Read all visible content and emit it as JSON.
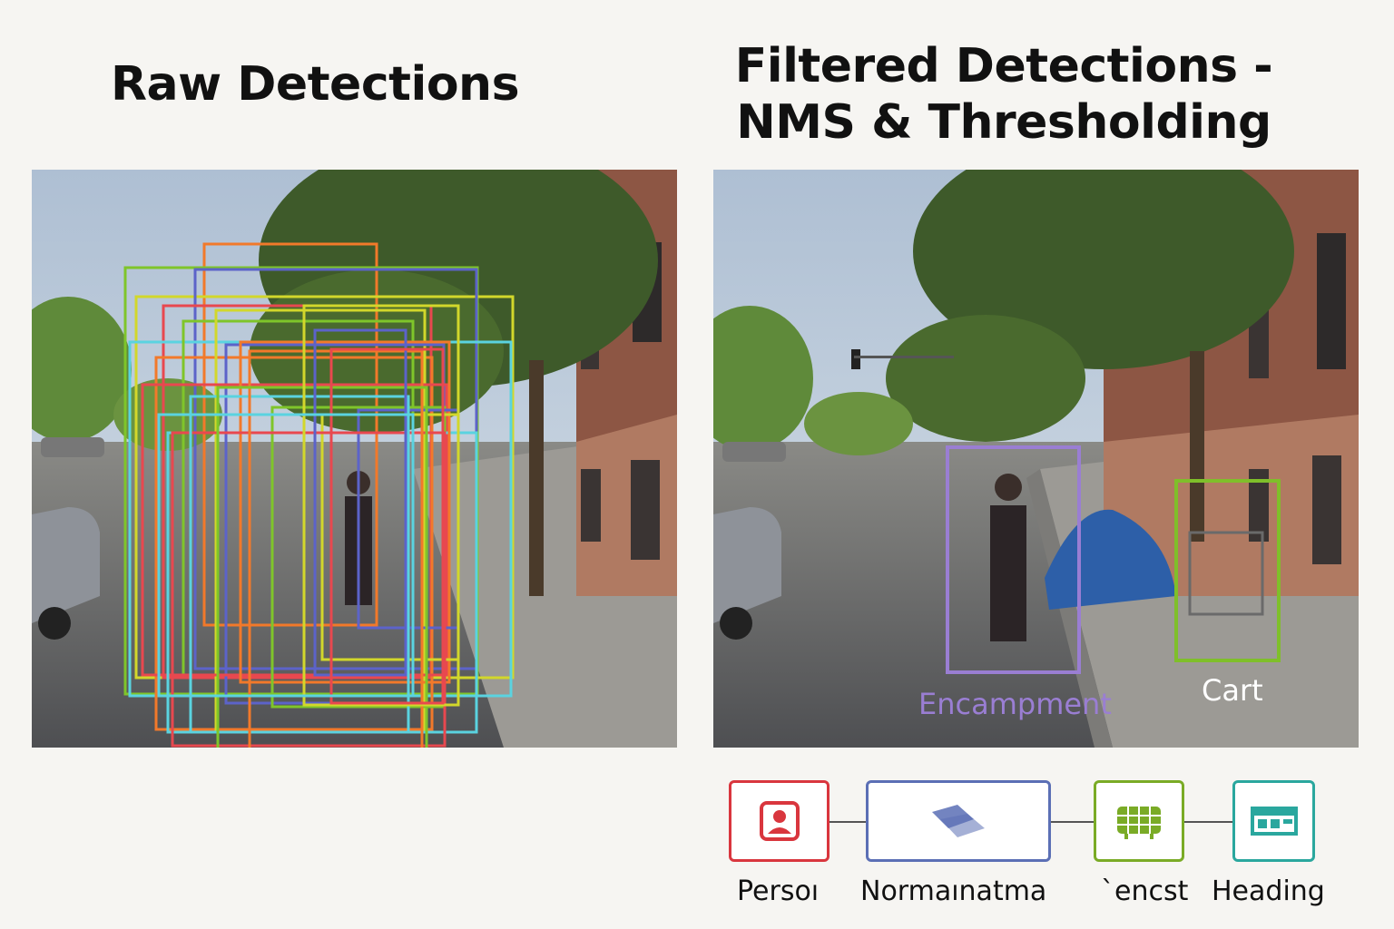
{
  "titles": {
    "raw": "Raw Detections",
    "filtered_line1": "Filtered Detections -",
    "filtered_line2": "NMS & Thresholding"
  },
  "detections": {
    "encampment_label": "Encampment",
    "cart_label": "Cart",
    "encampment_color": "#9a7ed3",
    "cart_color": "#7fbf2a"
  },
  "raw_box_colors": [
    "#f2792a",
    "#7fc52a",
    "#d2d72b",
    "#5c63c9",
    "#e8484f",
    "#5ad3e0"
  ],
  "pipeline": [
    {
      "label": "Persoı",
      "icon": "person-icon",
      "color": "#d9363e"
    },
    {
      "label": "Normaınatma",
      "icon": "layers-icon",
      "color": "#5b6fb5"
    },
    {
      "label": "`encst",
      "icon": "grid-icon",
      "color": "#7aab26"
    },
    {
      "label": "Heading",
      "icon": "table-icon",
      "color": "#2aa79e"
    }
  ]
}
